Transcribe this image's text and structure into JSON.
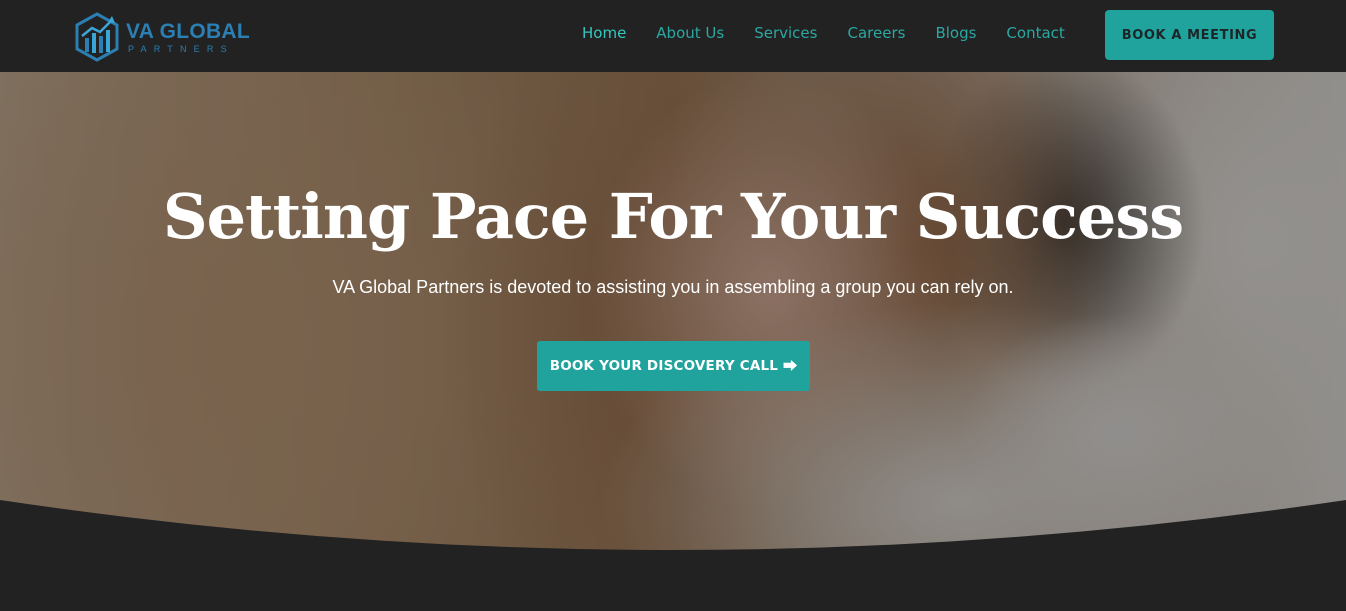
{
  "brand": {
    "name": "VA GLOBAL",
    "tagline": "PARTNERS",
    "logo_icon": "hexagon-growth-icon"
  },
  "nav": {
    "items": [
      {
        "label": "Home",
        "active": true
      },
      {
        "label": "About Us",
        "active": false
      },
      {
        "label": "Services",
        "active": false
      },
      {
        "label": "Careers",
        "active": false
      },
      {
        "label": "Blogs",
        "active": false
      },
      {
        "label": "Contact",
        "active": false
      }
    ],
    "cta_label": "BOOK A MEETING"
  },
  "hero": {
    "title": "Setting Pace For Your Success",
    "subtitle": "VA Global Partners is devoted to assisting you in assembling a group you can rely on.",
    "cta_label": "BOOK YOUR DISCOVERY CALL",
    "cta_icon": "arrow-right-icon",
    "cta_arrow": "⮕"
  },
  "colors": {
    "accent": "#21a39d",
    "nav_link": "#2aa8a1",
    "nav_active": "#35c6c0",
    "background": "#222222",
    "logo_blue": "#2b7fb3"
  }
}
